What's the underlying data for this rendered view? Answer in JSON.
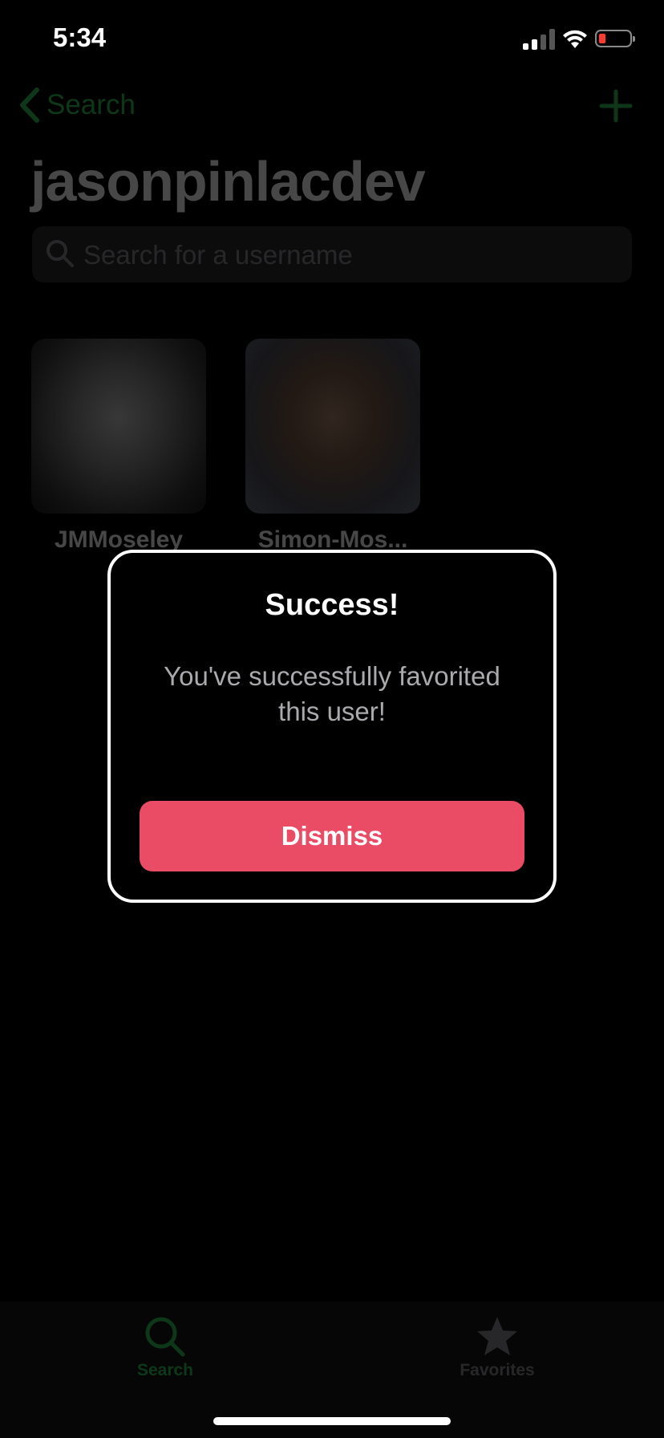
{
  "status_bar": {
    "time": "5:34"
  },
  "nav": {
    "back_label": "Search",
    "title": "jasonpinlacdev"
  },
  "search": {
    "placeholder": "Search for a username",
    "value": ""
  },
  "followers": [
    {
      "name": "JMMoseley"
    },
    {
      "name": "Simon-Mos..."
    }
  ],
  "alert": {
    "title": "Success!",
    "message": "You've successfully favorited this user!",
    "button_label": "Dismiss"
  },
  "tabs": [
    {
      "label": "Search",
      "icon": "search-icon",
      "selected": true
    },
    {
      "label": "Favorites",
      "icon": "star-icon",
      "selected": false
    }
  ],
  "colors": {
    "accent": "#34c759",
    "dismiss": "#ea4b65",
    "background": "#000000"
  }
}
